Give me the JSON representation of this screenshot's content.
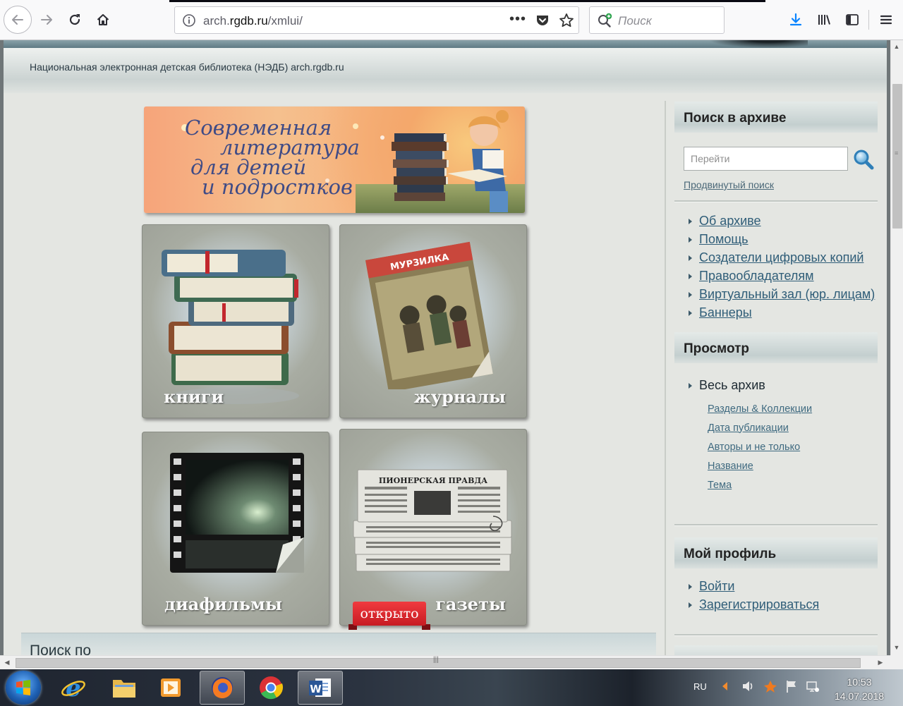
{
  "browser": {
    "url_prefix": "arch.",
    "url_domain": "rgdb.ru",
    "url_path": "/xmlui/",
    "page_actions": "•••",
    "search_placeholder": "Поиск"
  },
  "site": {
    "header_title": "Национальная электронная детская библиотека (НЭДБ) arch.rgdb.ru",
    "banner_lines": [
      "Современная",
      "литература",
      "для детей",
      "и подростков"
    ]
  },
  "tiles": {
    "books": "книги",
    "magazines": "журналы",
    "magazine_cover_title": "МУРЗИЛКА",
    "filmstrips": "диафильмы",
    "newspapers": "газеты",
    "newspaper_masthead": "ПИОНЕРСКАЯ ПРАВДА",
    "open_ribbon": "открыто"
  },
  "search_by": "Поиск по",
  "sidebar": {
    "search_title": "Поиск в архиве",
    "goto_placeholder": "Перейти",
    "advanced_search": "Продвинутый поиск",
    "info_links": [
      "Об архиве",
      "Помощь",
      "Создатели цифровых копий",
      "Правообладателям",
      "Виртуальный зал (юр. лицам)",
      "Баннеры"
    ],
    "browse_title": "Просмотр",
    "browse_root": "Весь архив",
    "browse_links": [
      "Разделы & Коллекции",
      "Дата публикации",
      "Авторы и не только",
      "Название",
      "Тема"
    ],
    "profile_title": "Мой профиль",
    "profile_links": [
      "Войти",
      "Зарегистрироваться"
    ]
  },
  "taskbar": {
    "language": "RU",
    "time": "10:53",
    "date": "14.07.2018",
    "apps": [
      "internet-explorer",
      "file-explorer",
      "media-player",
      "firefox",
      "chrome",
      "word"
    ],
    "active_app": "firefox"
  },
  "colors": {
    "link": "#2f5d78",
    "download_accent": "#0a84ff",
    "ribbon_red": "#e0262d"
  }
}
